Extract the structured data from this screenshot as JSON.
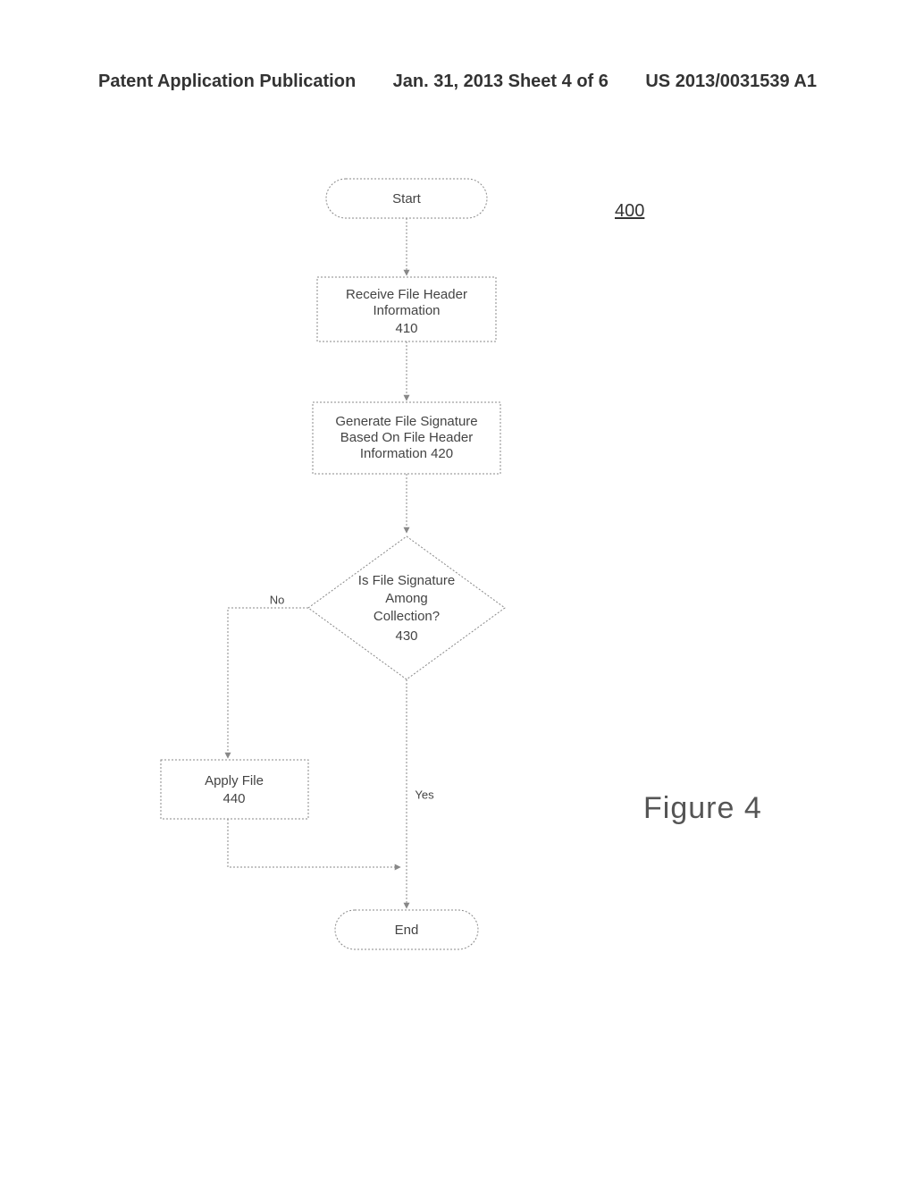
{
  "header": {
    "left": "Patent Application Publication",
    "center": "Jan. 31, 2013  Sheet 4 of 6",
    "right": "US 2013/0031539 A1"
  },
  "figure": {
    "reference": "400",
    "label": "Figure 4"
  },
  "chart_data": {
    "type": "flowchart",
    "title": "",
    "nodes": [
      {
        "id": "start",
        "type": "terminator",
        "label": "Start"
      },
      {
        "id": "n410",
        "type": "process",
        "label": "Receive File Header Information",
        "ref": "410"
      },
      {
        "id": "n420",
        "type": "process",
        "label": "Generate File Signature Based On File Header Information",
        "ref": "420"
      },
      {
        "id": "n430",
        "type": "decision",
        "label": "Is File Signature Among Collection?",
        "ref": "430"
      },
      {
        "id": "n440",
        "type": "process",
        "label": "Apply File",
        "ref": "440"
      },
      {
        "id": "end",
        "type": "terminator",
        "label": "End"
      }
    ],
    "edges": [
      {
        "from": "start",
        "to": "n410"
      },
      {
        "from": "n410",
        "to": "n420"
      },
      {
        "from": "n420",
        "to": "n430"
      },
      {
        "from": "n430",
        "to": "n440",
        "label": "No"
      },
      {
        "from": "n430",
        "to": "end",
        "label": "Yes"
      },
      {
        "from": "n440",
        "to": "end"
      }
    ]
  }
}
